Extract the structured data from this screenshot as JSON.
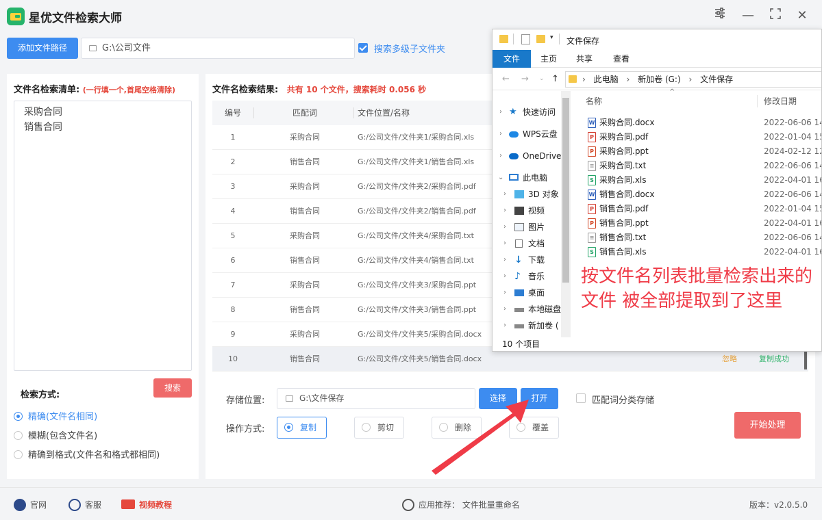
{
  "app": {
    "title": "星优文件检索大师"
  },
  "toolbar": {
    "add_path_label": "添加文件路径",
    "path_value": "G:\\公司文件",
    "subfolder_label": "搜索多级子文件夹",
    "subfolder_checked": true
  },
  "left_panel": {
    "title": "文件名检索清单:",
    "hint": "(一行填一个,首尾空格清除)",
    "items": [
      "采购合同",
      "销售合同"
    ],
    "search_label": "搜索",
    "mode_title": "检索方式:",
    "modes": [
      {
        "label": "精确(文件名相同)",
        "selected": true
      },
      {
        "label": "模糊(包含文件名)",
        "selected": false
      },
      {
        "label": "精确到格式(文件名和格式都相同)",
        "selected": false
      }
    ]
  },
  "results": {
    "title": "文件名检索结果:",
    "summary": "共有 10 个文件，搜索耗时 0.056 秒",
    "columns": [
      "编号",
      "匹配词",
      "文件位置/名称"
    ],
    "rows": [
      {
        "no": "1",
        "keyword": "采购合同",
        "path": "G:/公司文件/文件夹1/采购合同.xls"
      },
      {
        "no": "2",
        "keyword": "销售合同",
        "path": "G:/公司文件/文件夹1/销售合同.xls"
      },
      {
        "no": "3",
        "keyword": "采购合同",
        "path": "G:/公司文件/文件夹2/采购合同.pdf"
      },
      {
        "no": "4",
        "keyword": "销售合同",
        "path": "G:/公司文件/文件夹2/销售合同.pdf"
      },
      {
        "no": "5",
        "keyword": "采购合同",
        "path": "G:/公司文件/文件夹4/采购合同.txt"
      },
      {
        "no": "6",
        "keyword": "销售合同",
        "path": "G:/公司文件/文件夹4/销售合同.txt"
      },
      {
        "no": "7",
        "keyword": "采购合同",
        "path": "G:/公司文件/文件夹3/采购合同.ppt"
      },
      {
        "no": "8",
        "keyword": "销售合同",
        "path": "G:/公司文件/文件夹3/销售合同.ppt"
      },
      {
        "no": "9",
        "keyword": "采购合同",
        "path": "G:/公司文件/文件夹5/采购合同.docx"
      },
      {
        "no": "10",
        "keyword": "销售合同",
        "path": "G:/公司文件/文件夹5/销售合同.docx",
        "status_skip": "忽略",
        "status_ok": "复制成功"
      }
    ]
  },
  "save": {
    "label": "存储位置:",
    "value": "G:\\文件保存",
    "choose_label": "选择",
    "open_label": "打开",
    "classify_label": "匹配词分类存储",
    "classify_checked": false
  },
  "operation": {
    "label": "操作方式:",
    "options": [
      {
        "label": "复制",
        "selected": true
      },
      {
        "label": "剪切",
        "selected": false
      },
      {
        "label": "删除",
        "selected": false
      },
      {
        "label": "覆盖",
        "selected": false
      }
    ],
    "start_label": "开始处理"
  },
  "footer": {
    "website_label": "官网",
    "service_label": "客服",
    "video_label": "视频教程",
    "recommend_prefix": "应用推荐：",
    "recommend_app": "文件批量重命名",
    "version_label": "版本：v2.0.5.0"
  },
  "explorer": {
    "title": "文件保存",
    "tabs": [
      "文件",
      "主页",
      "共享",
      "查看"
    ],
    "breadcrumb": [
      "此电脑",
      "新加卷 (G:)",
      "文件保存"
    ],
    "tree": [
      {
        "label": "快速访问",
        "icon": "star-icon"
      },
      {
        "label": "WPS云盘",
        "icon": "cloud-icon"
      },
      {
        "label": "OneDrive",
        "icon": "onedrive-icon"
      },
      {
        "label": "此电脑",
        "icon": "computer-icon",
        "expanded": true
      },
      {
        "label": "3D 对象",
        "icon": "cube-icon"
      },
      {
        "label": "视频",
        "icon": "film-icon"
      },
      {
        "label": "图片",
        "icon": "picture-icon"
      },
      {
        "label": "文档",
        "icon": "document-icon"
      },
      {
        "label": "下载",
        "icon": "download-icon"
      },
      {
        "label": "音乐",
        "icon": "music-icon"
      },
      {
        "label": "桌面",
        "icon": "desktop-icon"
      },
      {
        "label": "本地磁盘",
        "icon": "drive-icon"
      },
      {
        "label": "新加卷 (",
        "icon": "drive-icon"
      }
    ],
    "columns": [
      "名称",
      "修改日期"
    ],
    "files": [
      {
        "name": "采购合同.docx",
        "date": "2022-06-06 14",
        "type": "word"
      },
      {
        "name": "采购合同.pdf",
        "date": "2022-01-04 15",
        "type": "pdf"
      },
      {
        "name": "采购合同.ppt",
        "date": "2024-02-12 12",
        "type": "ppt"
      },
      {
        "name": "采购合同.txt",
        "date": "2022-06-06 14",
        "type": "txt"
      },
      {
        "name": "采购合同.xls",
        "date": "2022-04-01 16",
        "type": "xls"
      },
      {
        "name": "销售合同.docx",
        "date": "2022-06-06 14",
        "type": "word"
      },
      {
        "name": "销售合同.pdf",
        "date": "2022-01-04 15",
        "type": "pdf"
      },
      {
        "name": "销售合同.ppt",
        "date": "2022-04-01 16",
        "type": "ppt"
      },
      {
        "name": "销售合同.txt",
        "date": "2022-06-06 14",
        "type": "txt"
      },
      {
        "name": "销售合同.xls",
        "date": "2022-04-01 16",
        "type": "xls"
      }
    ],
    "item_count": "10 个项目"
  },
  "annotation": {
    "text": "按文件名列表批量检索出来的文件 被全部提取到了这里"
  },
  "colors": {
    "primary": "#3d8cf0",
    "danger": "#ef6a6a",
    "annotation": "#ef3b47",
    "success": "#2fb36a",
    "warning": "#e6a23c"
  }
}
